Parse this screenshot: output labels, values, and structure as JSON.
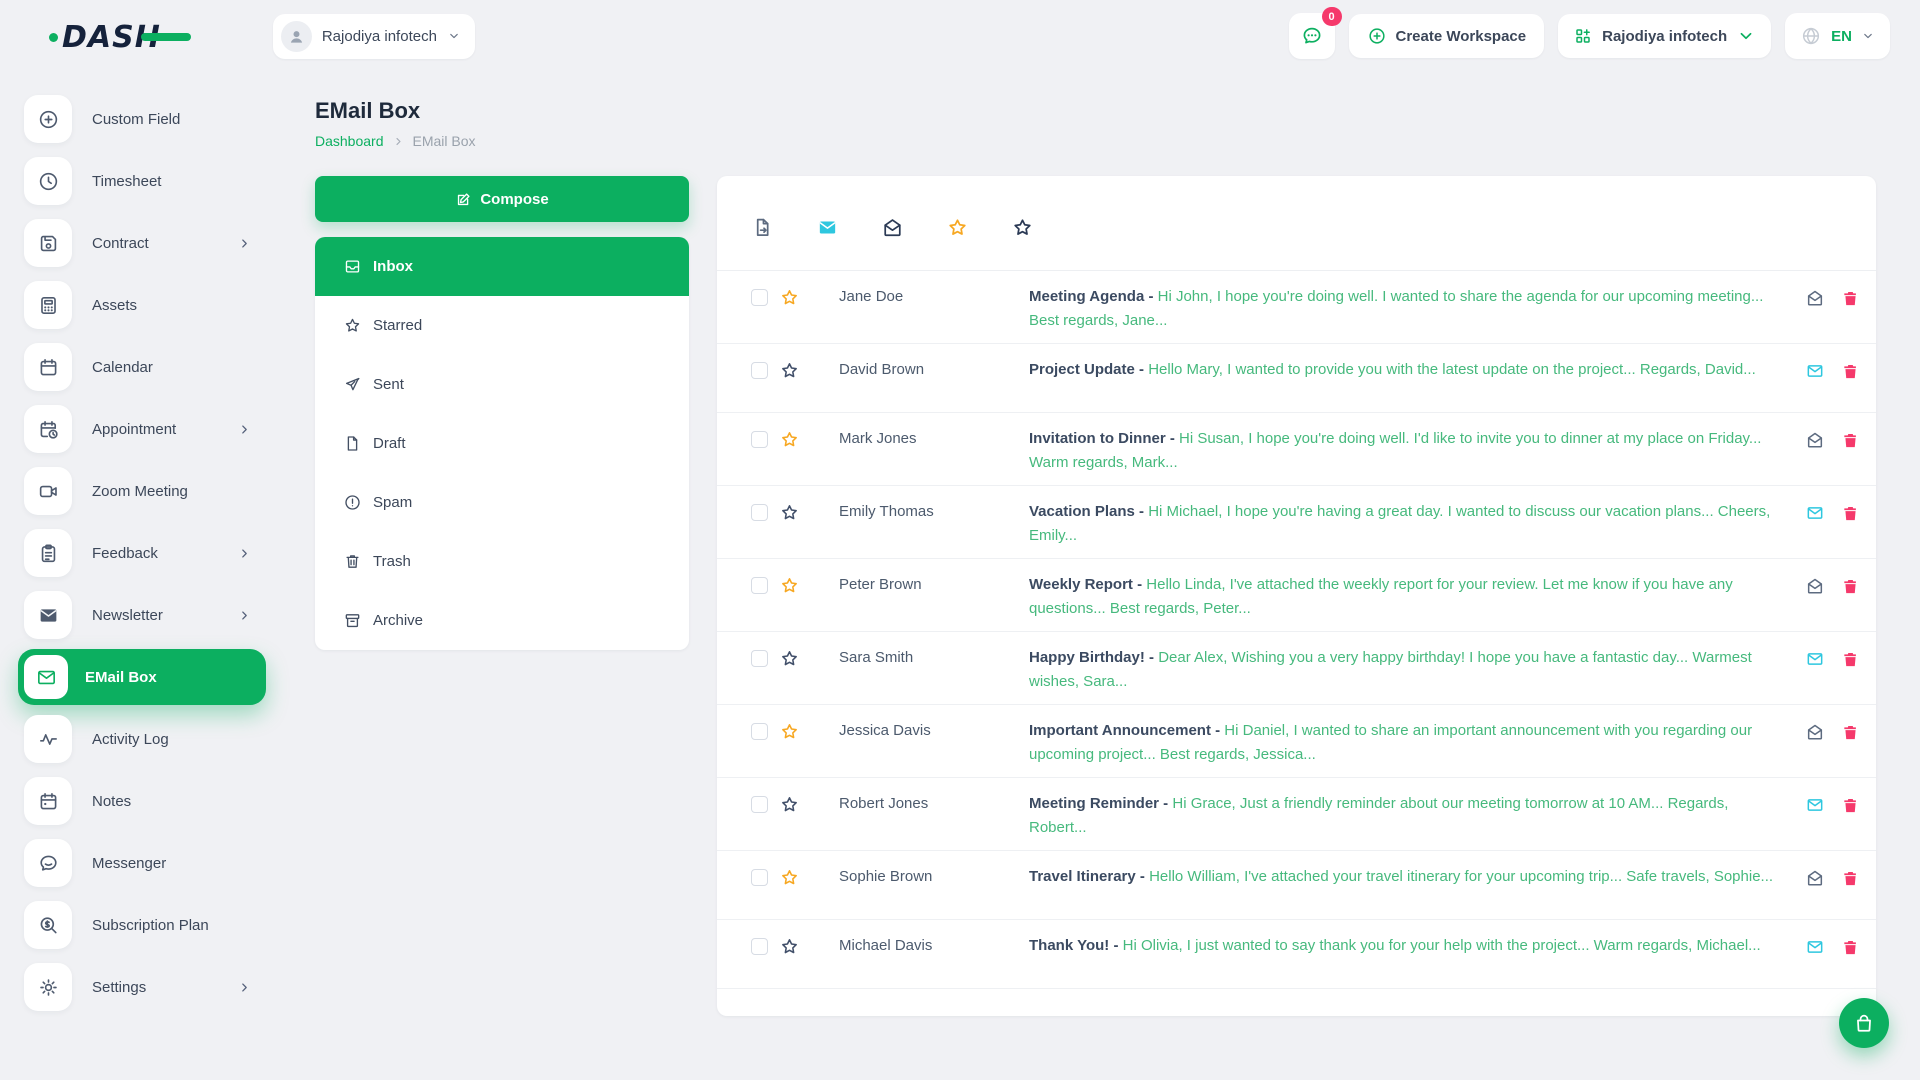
{
  "brand": {
    "logo_text": "DASH"
  },
  "header": {
    "workspace_selector": {
      "label": "Rajodiya infotech"
    },
    "messages_badge": "0",
    "create_workspace_label": "Create Workspace",
    "company_selector": {
      "label": "Rajodiya infotech"
    },
    "language": {
      "code": "EN"
    }
  },
  "sidebar": {
    "items": [
      {
        "label": "Custom Field",
        "icon": "plus-circle-icon",
        "has_submenu": false,
        "active": false
      },
      {
        "label": "Timesheet",
        "icon": "clock-icon",
        "has_submenu": false,
        "active": false
      },
      {
        "label": "Contract",
        "icon": "save-icon",
        "has_submenu": true,
        "active": false
      },
      {
        "label": "Assets",
        "icon": "calculator-icon",
        "has_submenu": false,
        "active": false
      },
      {
        "label": "Calendar",
        "icon": "calendar-icon",
        "has_submenu": false,
        "active": false
      },
      {
        "label": "Appointment",
        "icon": "calendar-clock-icon",
        "has_submenu": true,
        "active": false
      },
      {
        "label": "Zoom Meeting",
        "icon": "video-icon",
        "has_submenu": false,
        "active": false
      },
      {
        "label": "Feedback",
        "icon": "clipboard-icon",
        "has_submenu": true,
        "active": false
      },
      {
        "label": "Newsletter",
        "icon": "envelope-filled-icon",
        "has_submenu": true,
        "active": false
      },
      {
        "label": "EMail Box",
        "icon": "envelope-icon",
        "has_submenu": false,
        "active": true
      },
      {
        "label": "Activity Log",
        "icon": "activity-icon",
        "has_submenu": false,
        "active": false
      },
      {
        "label": "Notes",
        "icon": "notes-icon",
        "has_submenu": false,
        "active": false
      },
      {
        "label": "Messenger",
        "icon": "chat-icon",
        "has_submenu": false,
        "active": false
      },
      {
        "label": "Subscription Plan",
        "icon": "search-dollar-icon",
        "has_submenu": false,
        "active": false
      },
      {
        "label": "Settings",
        "icon": "gear-icon",
        "has_submenu": true,
        "active": false
      }
    ]
  },
  "page": {
    "title": "EMail Box",
    "breadcrumb": {
      "home": "Dashboard",
      "current": "EMail Box"
    }
  },
  "mailbox": {
    "compose_label": "Compose",
    "folders": [
      {
        "label": "Inbox",
        "icon": "inbox-icon",
        "active": true
      },
      {
        "label": "Starred",
        "icon": "star-icon",
        "active": false
      },
      {
        "label": "Sent",
        "icon": "send-icon",
        "active": false
      },
      {
        "label": "Draft",
        "icon": "file-icon",
        "active": false
      },
      {
        "label": "Spam",
        "icon": "alert-circle-icon",
        "active": false
      },
      {
        "label": "Trash",
        "icon": "trash-icon",
        "active": false
      },
      {
        "label": "Archive",
        "icon": "archive-icon",
        "active": false
      }
    ],
    "toolbar": [
      {
        "name": "move-file-icon",
        "icon": "file-export-icon",
        "style": "slate"
      },
      {
        "name": "mark-unread-icon",
        "icon": "envelope-closed-icon",
        "style": "cyan"
      },
      {
        "name": "mark-read-icon",
        "icon": "envelope-open-icon",
        "style": "navy"
      },
      {
        "name": "starred-filter-icon",
        "icon": "star-icon",
        "style": "orange"
      },
      {
        "name": "unstarred-filter-icon",
        "icon": "star-icon",
        "style": "navy"
      }
    ],
    "emails": [
      {
        "sender": "Jane Doe",
        "subject": "Meeting Agenda -",
        "preview": "Hi John, I hope you're doing well. I wanted to share the agenda for our upcoming meeting... Best regards, Jane...",
        "starred": true,
        "unread": false
      },
      {
        "sender": "David Brown",
        "subject": "Project Update -",
        "preview": "Hello Mary, I wanted to provide you with the latest update on the project... Regards, David...",
        "starred": false,
        "unread": true
      },
      {
        "sender": "Mark Jones",
        "subject": "Invitation to Dinner -",
        "preview": "Hi Susan, I hope you're doing well. I'd like to invite you to dinner at my place on Friday... Warm regards, Mark...",
        "starred": true,
        "unread": false
      },
      {
        "sender": "Emily Thomas",
        "subject": "Vacation Plans -",
        "preview": "Hi Michael, I hope you're having a great day. I wanted to discuss our vacation plans... Cheers, Emily...",
        "starred": false,
        "unread": true
      },
      {
        "sender": "Peter Brown",
        "subject": "Weekly Report -",
        "preview": "Hello Linda, I've attached the weekly report for your review. Let me know if you have any questions... Best regards, Peter...",
        "starred": true,
        "unread": false
      },
      {
        "sender": "Sara Smith",
        "subject": "Happy Birthday! -",
        "preview": "Dear Alex, Wishing you a very happy birthday! I hope you have a fantastic day... Warmest wishes, Sara...",
        "starred": false,
        "unread": true
      },
      {
        "sender": "Jessica Davis",
        "subject": "Important Announcement -",
        "preview": "Hi Daniel, I wanted to share an important announcement with you regarding our upcoming project... Best regards, Jessica...",
        "starred": true,
        "unread": false
      },
      {
        "sender": "Robert Jones",
        "subject": "Meeting Reminder -",
        "preview": "Hi Grace, Just a friendly reminder about our meeting tomorrow at 10 AM... Regards, Robert...",
        "starred": false,
        "unread": true
      },
      {
        "sender": "Sophie Brown",
        "subject": "Travel Itinerary -",
        "preview": "Hello William, I've attached your travel itinerary for your upcoming trip... Safe travels, Sophie...",
        "starred": true,
        "unread": false
      },
      {
        "sender": "Michael Davis",
        "subject": "Thank You! -",
        "preview": "Hi Olivia, I just wanted to say thank you for your help with the project... Warm regards, Michael...",
        "starred": false,
        "unread": true
      }
    ]
  },
  "fab": {
    "icon": "shopping-bag-icon"
  },
  "colors": {
    "accent_green": "#0CAF60",
    "star_orange": "#F7A823",
    "unread_cyan": "#2EC7DF",
    "danger_pink": "#F5396B",
    "preview_green": "#46B97D"
  }
}
